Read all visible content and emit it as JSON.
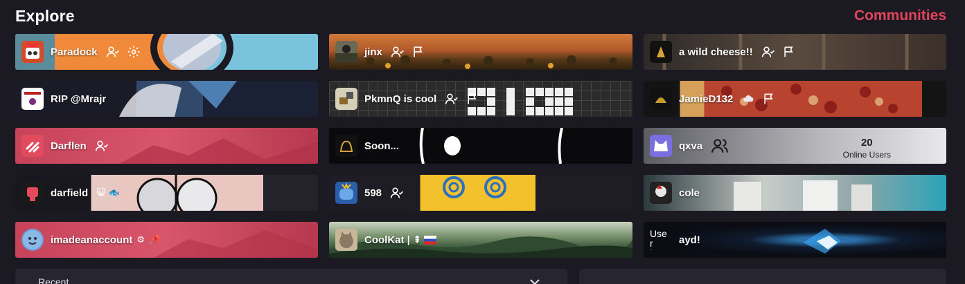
{
  "header": {
    "title": "Explore",
    "communities_link": "Communities"
  },
  "cards": [
    {
      "name": "Paradock"
    },
    {
      "name": "jinx"
    },
    {
      "name": "a wild cheese!!"
    },
    {
      "name": "RIP @Mrajr"
    },
    {
      "name": "PkmnQ is cool"
    },
    {
      "name": "JamieD132"
    },
    {
      "name": "Darflen"
    },
    {
      "name": "Soon..."
    },
    {
      "name": "qxva",
      "online_count": "20",
      "online_label": "Online Users"
    },
    {
      "name": "darfield"
    },
    {
      "name": "598"
    },
    {
      "name": "cole"
    },
    {
      "name": "imadeanaccount"
    },
    {
      "name": "CoolKat | ",
      "suffix": "⇞"
    },
    {
      "name": "ayd!",
      "avatar_alt": "Use r icon"
    }
  ],
  "footer": {
    "recent_label": "Recent"
  },
  "colors": {
    "accent": "#e0455c",
    "background": "#1b1a23"
  }
}
